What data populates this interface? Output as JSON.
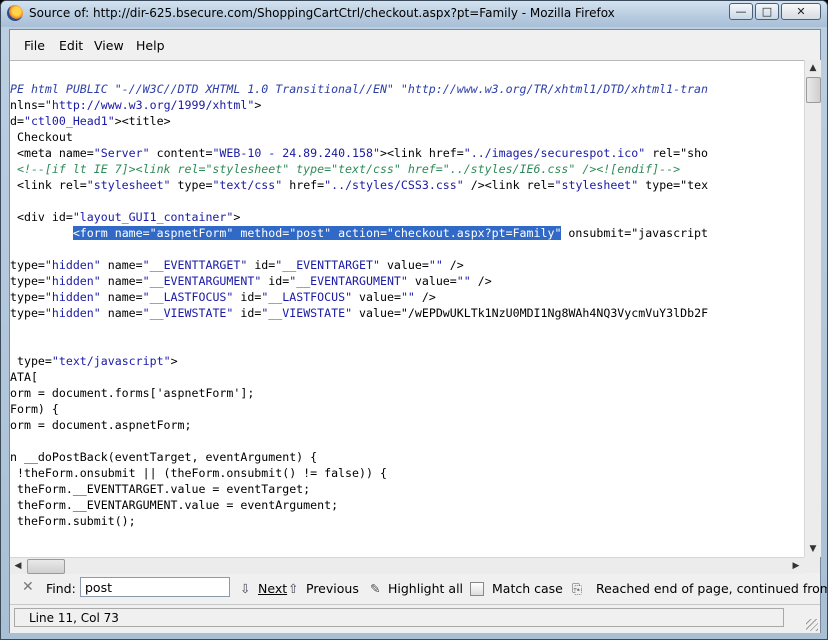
{
  "window": {
    "title": "Source of: http://dir-625.bsecure.com/ShoppingCartCtrl/checkout.aspx?pt=Family - Mozilla Firefox",
    "app_icon": "firefox-icon",
    "controls": {
      "minimize": "—",
      "maximize": "□",
      "close": "✕"
    }
  },
  "menu": {
    "file": "File",
    "edit": "Edit",
    "view": "View",
    "help": "Help"
  },
  "source_lines": [
    "PE html PUBLIC \"-//W3C//DTD XHTML 1.0 Transitional//EN\" \"http://www.w3.org/TR/xhtml1/DTD/xhtml1-tran",
    "nlns=\"http://www.w3.org/1999/xhtml\">",
    "d=\"ctl00_Head1\"><title>",
    " Checkout",
    " <meta name=\"Server\" content=\"WEB-10 - 24.89.240.158\"><link href=\"../images/securespot.ico\" rel=\"sho",
    " <!--[if lt IE 7]><link rel=\"stylesheet\" type=\"text/css\" href=\"../styles/IE6.css\" /><![endif]-->",
    " <link rel=\"stylesheet\" type=\"text/css\" href=\"../styles/CSS3.css\" /><link rel=\"stylesheet\" type=\"tex",
    "",
    " <div id=\"layout_GUI1_container\">",
    "         <form name=\"aspnetForm\" method=\"post\" action=\"checkout.aspx?pt=Family\" onsubmit=\"javascript",
    "",
    "type=\"hidden\" name=\"__EVENTTARGET\" id=\"__EVENTTARGET\" value=\"\" />",
    "type=\"hidden\" name=\"__EVENTARGUMENT\" id=\"__EVENTARGUMENT\" value=\"\" />",
    "type=\"hidden\" name=\"__LASTFOCUS\" id=\"__LASTFOCUS\" value=\"\" />",
    "type=\"hidden\" name=\"__VIEWSTATE\" id=\"__VIEWSTATE\" value=\"/wEPDwUKLTk1NzU0MDI1Ng8WAh4NQ3VycmVuY3lDb2F",
    "",
    "",
    " type=\"text/javascript\">",
    "ATA[",
    "orm = document.forms['aspnetForm'];",
    "Form) {",
    "orm = document.aspnetForm;",
    "",
    "n __doPostBack(eventTarget, eventArgument) {",
    " !theForm.onsubmit || (theForm.onsubmit() != false)) {",
    " theForm.__EVENTTARGET.value = eventTarget;",
    " theForm.__EVENTARGUMENT.value = eventArgument;",
    " theForm.submit();"
  ],
  "highlight": {
    "line_index": 9,
    "text": "<form name=\"aspnetForm\" method=\"post\" action=\"checkout.aspx?pt=Family\""
  },
  "findbar": {
    "close_icon": "close-icon",
    "label": "Find:",
    "value": "post",
    "next": "Next",
    "previous": "Previous",
    "highlight_all": "Highlight all",
    "match_case": "Match case",
    "message": "Reached end of page, continued from top"
  },
  "status": {
    "text": "Line 11, Col 73"
  }
}
